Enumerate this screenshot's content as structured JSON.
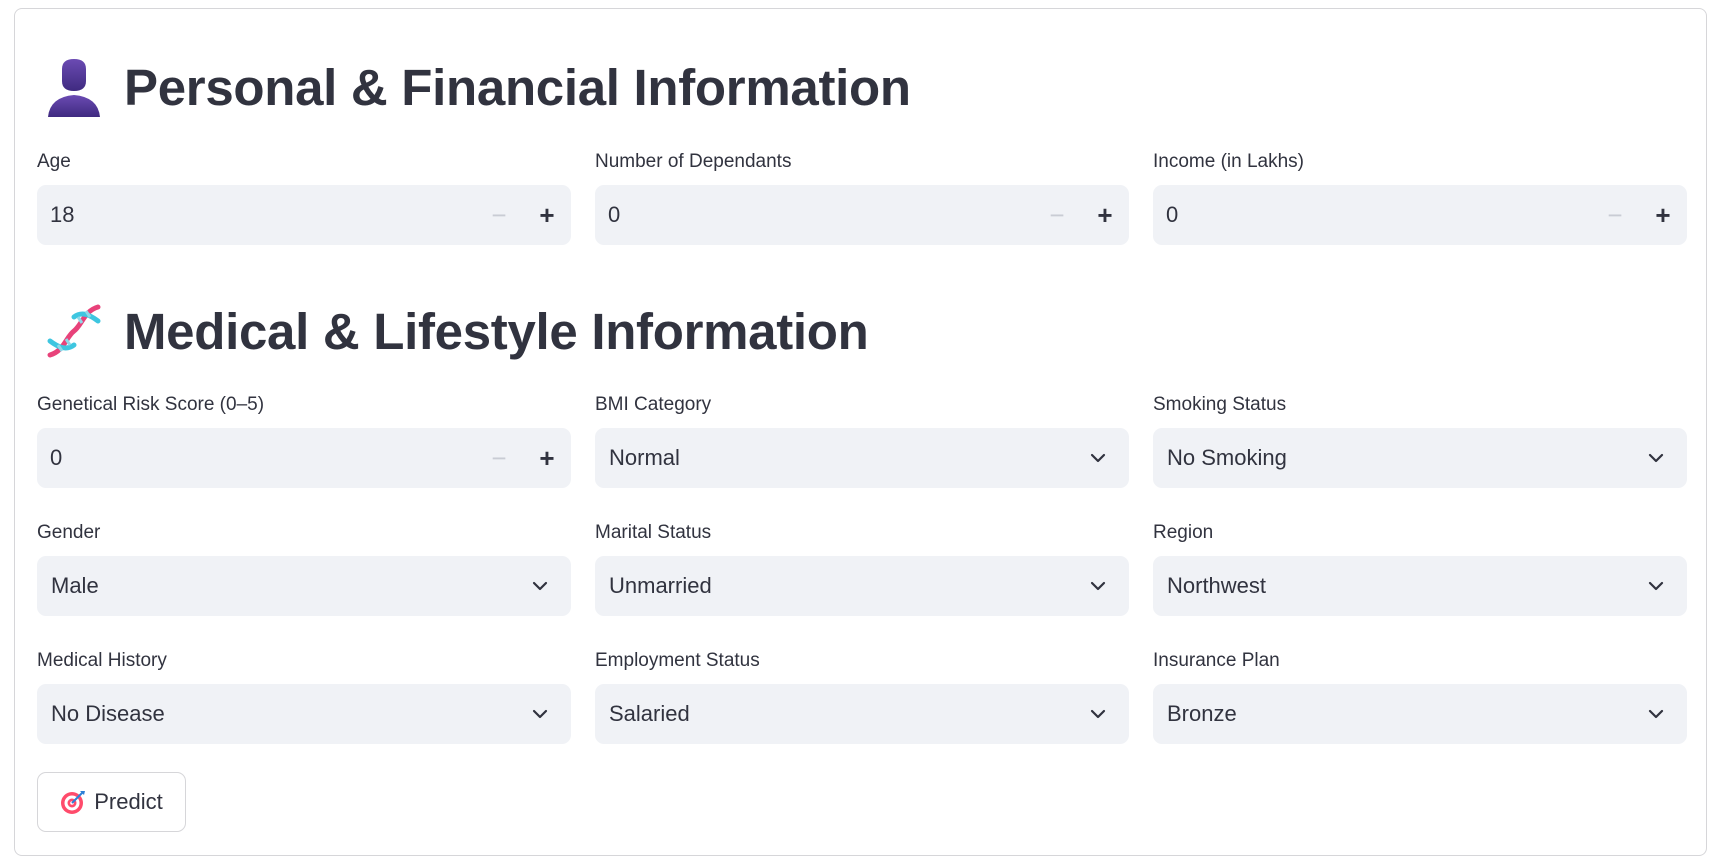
{
  "personal": {
    "title": "Personal & Financial Information",
    "icon": "person-silhouette-icon",
    "fields": {
      "age": {
        "label": "Age",
        "value": "18"
      },
      "dependants": {
        "label": "Number of Dependants",
        "value": "0"
      },
      "income": {
        "label": "Income (in Lakhs)",
        "value": "0"
      }
    }
  },
  "medical": {
    "title": "Medical & Lifestyle Information",
    "icon": "dna-icon",
    "fields": {
      "genetic_risk": {
        "label": "Genetical Risk Score (0–5)",
        "value": "0"
      },
      "bmi": {
        "label": "BMI Category",
        "value": "Normal"
      },
      "smoking": {
        "label": "Smoking Status",
        "value": "No Smoking"
      },
      "gender": {
        "label": "Gender",
        "value": "Male"
      },
      "marital": {
        "label": "Marital Status",
        "value": "Unmarried"
      },
      "region": {
        "label": "Region",
        "value": "Northwest"
      },
      "medical_history": {
        "label": "Medical History",
        "value": "No Disease"
      },
      "employment": {
        "label": "Employment Status",
        "value": "Salaried"
      },
      "plan": {
        "label": "Insurance Plan",
        "value": "Bronze"
      }
    }
  },
  "stepper": {
    "minus": "−",
    "plus": "+"
  },
  "predict": {
    "label": "Predict",
    "icon": "target-icon"
  },
  "colors": {
    "accent": "#ff4b4b",
    "input_bg": "#f0f2f6",
    "text": "#31333f"
  }
}
